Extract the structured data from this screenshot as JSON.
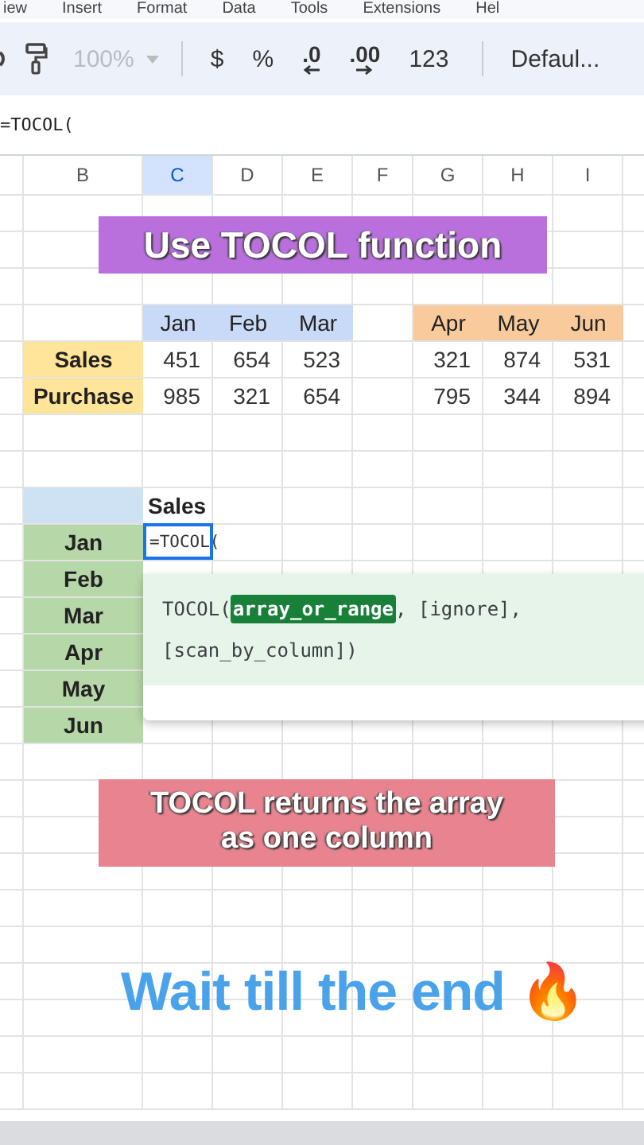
{
  "menu": [
    "iew",
    "Insert",
    "Format",
    "Data",
    "Tools",
    "Extensions",
    "Hel"
  ],
  "toolbar": {
    "zoom": {
      "value": "100%",
      "disabled": true
    },
    "buttons": [
      {
        "kind": "text",
        "label": "$"
      },
      {
        "kind": "text",
        "label": "%"
      },
      {
        "kind": "decimal-decrease",
        "label": ".0"
      },
      {
        "kind": "decimal-increase",
        "label": ".00"
      },
      {
        "kind": "text",
        "label": "123"
      }
    ],
    "font": "Defaul..."
  },
  "formula_bar": {
    "value": "=TOCOL("
  },
  "columns": [
    {
      "label": "B",
      "selected": false
    },
    {
      "label": "C",
      "selected": true
    },
    {
      "label": "D",
      "selected": false
    },
    {
      "label": "E",
      "selected": false
    },
    {
      "label": "F",
      "selected": false
    },
    {
      "label": "G",
      "selected": false
    },
    {
      "label": "H",
      "selected": false
    },
    {
      "label": "I",
      "selected": false
    }
  ],
  "rows": [
    {},
    {},
    {},
    {
      "c": {
        "text": "Jan",
        "color": "#c9daf8",
        "bold": false,
        "selected": false
      },
      "d": {
        "text": "Feb",
        "color": "#c9daf8",
        "bold": false,
        "selected": false
      },
      "e": {
        "text": "Mar",
        "color": "#c9daf8",
        "bold": false,
        "selected": false
      },
      "g": {
        "text": "Apr",
        "color": "#f9cb9c",
        "bold": false,
        "selected": false
      },
      "h": {
        "text": "May",
        "color": "#f9cb9c",
        "bold": false,
        "selected": false
      },
      "i": {
        "text": "Jun",
        "color": "#f9cb9c",
        "bold": false,
        "selected": false
      }
    },
    {
      "b": {
        "text": "Sales",
        "color": "#ffe599",
        "bold": true,
        "selected": false
      },
      "c": {
        "text": "451",
        "bold": false,
        "selected": false
      },
      "d": {
        "text": "654",
        "bold": false,
        "selected": false
      },
      "e": {
        "text": "523",
        "bold": false,
        "selected": false
      },
      "g": {
        "text": "321",
        "bold": false,
        "selected": false
      },
      "h": {
        "text": "874",
        "bold": false,
        "selected": false
      },
      "i": {
        "text": "531",
        "bold": false,
        "selected": false
      }
    },
    {
      "b": {
        "text": "Purchase",
        "color": "#ffe599",
        "bold": true,
        "selected": false
      },
      "c": {
        "text": "985",
        "bold": false,
        "selected": false
      },
      "d": {
        "text": "321",
        "bold": false,
        "selected": false
      },
      "e": {
        "text": "654",
        "bold": false,
        "selected": false
      },
      "g": {
        "text": "795",
        "bold": false,
        "selected": false
      },
      "h": {
        "text": "344",
        "bold": false,
        "selected": false
      },
      "i": {
        "text": "894",
        "bold": false,
        "selected": false
      }
    },
    {},
    {},
    {
      "b": {
        "color": "#cfe2f3",
        "selected": false
      },
      "c": {
        "text": "Sales",
        "bold": true,
        "selected": false
      }
    },
    {
      "b": {
        "text": "Jan",
        "color": "#b6d7a8",
        "bold": true,
        "selected": false
      },
      "c": {
        "text": "=TOCOL(",
        "bold": false,
        "selected": true
      }
    },
    {
      "b": {
        "text": "Feb",
        "color": "#b6d7a8",
        "bold": true,
        "selected": false
      }
    },
    {
      "b": {
        "text": "Mar",
        "color": "#b6d7a8",
        "bold": true,
        "selected": false
      }
    },
    {
      "b": {
        "text": "Apr",
        "color": "#b6d7a8",
        "bold": true,
        "selected": false
      }
    },
    {
      "b": {
        "text": "May",
        "color": "#b6d7a8",
        "bold": true,
        "selected": false
      }
    },
    {
      "b": {
        "text": "Jun",
        "color": "#b6d7a8",
        "bold": true,
        "selected": false
      }
    }
  ],
  "formula_hint": {
    "parts": [
      {
        "text": "TOCOL(",
        "selected": false
      },
      {
        "text": "array_or_range",
        "selected": true
      },
      {
        "text": ", [ignore], [scan_by_column])",
        "selected": false
      }
    ]
  },
  "captions": [
    {
      "text": "Use TOCOL function",
      "color": "#b970dd"
    },
    {
      "text": "TOCOL returns the array as one column",
      "color": "#e8848f"
    }
  ],
  "footer_caption": {
    "text": "Wait till the end 🔥"
  }
}
